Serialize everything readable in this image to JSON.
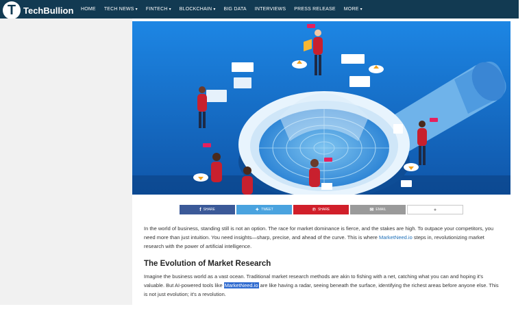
{
  "site": {
    "logo_letter": "T",
    "logo_text": "TechBullion"
  },
  "nav": [
    {
      "label": "HOME",
      "caret": ""
    },
    {
      "label": "TECH NEWS",
      "caret": "▾"
    },
    {
      "label": "FINTECH",
      "caret": "▾"
    },
    {
      "label": "BLOCKCHAIN",
      "caret": "▾"
    },
    {
      "label": "BIG DATA",
      "caret": ""
    },
    {
      "label": "INTERVIEWS",
      "caret": ""
    },
    {
      "label": "PRESS RELEASE",
      "caret": ""
    },
    {
      "label": "MORE",
      "caret": "▾"
    }
  ],
  "share": {
    "facebook": "SHARE",
    "twitter": "TWEET",
    "pinterest": "SHARE",
    "email": "EMAIL",
    "comment_icon": "speech-bubble"
  },
  "article": {
    "intro_before": "In the world of business, standing still is not an option. The race for market dominance is fierce, and the stakes are high. To outpace your competitors, you need more than just intuition. You need insights—sharp, precise, and ahead of the curve. This is where ",
    "intro_link": "MarketNeed.io",
    "intro_after": " steps in, revolutionizing market research with the power of artificial intelligence.",
    "heading": "The Evolution of Market Research",
    "body_before": "Imagine the business world as a vast ocean. Traditional market research methods are akin to fishing with a net, catching what you can and hoping it's valuable. But AI-powered tools like ",
    "body_link": "MarketNeed.io",
    "body_after": " are like having a radar, seeing beneath the surface, identifying the richest areas before anyone else. This is not just evolution; it's a revolution."
  },
  "colors": {
    "navbar": "#123a52",
    "hero_bg": "#1a78d8",
    "accent_red": "#c8202e"
  }
}
